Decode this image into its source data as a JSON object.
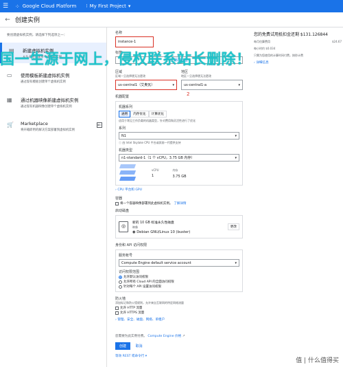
{
  "topbar": {
    "brand": "Google Cloud Platform",
    "project": "My First Project"
  },
  "header": {
    "title": "创建实例"
  },
  "left": {
    "intro": "要创建虚拟机实例，请选择下列选项之一：",
    "options": [
      {
        "label": "新建虚拟机实例",
        "desc": "从头开始创建单个虚拟机实例"
      },
      {
        "label": "使用模板新建虚拟机实例",
        "desc": "通过现有模板创建单个虚拟机实例"
      },
      {
        "label": "通过机器映像新建虚拟机实例",
        "desc": "通过现有机器映像创建单个虚拟机实例"
      },
      {
        "label": "Marketplace",
        "desc": "将开箱即用的解决方案部署到虚拟机实例"
      }
    ]
  },
  "form": {
    "name_label": "名称",
    "name_value": "instance-1",
    "label_label": "标签",
    "add_label": "+ 添加标签",
    "region_label": "区域",
    "region_hint": "区域一旦选择便无法更改",
    "region_value": "us-central1（艾奥瓦）",
    "zone_label": "地区",
    "zone_hint": "地区一旦选择便无法更改",
    "zone_value": "us-central1-a",
    "machine_config": "机器配置",
    "machine_family": "机器系列",
    "tabs": [
      "通用",
      "内存优化",
      "计算优化"
    ],
    "family_desc": "适用于常见工作负载的机器类型，针对费用和灵活性进行了优化",
    "series_label": "系列",
    "series_value": "N1",
    "series_hint": "由 Intel Skylake CPU 平台或其前一代提供支持",
    "type_label": "机器类型",
    "type_value": "n1-standard-1（1 个 vCPU，3.75 GB 内存）",
    "vcpu_head": "vCPU",
    "mem_head": "内存",
    "vcpu_value": "1",
    "mem_value": "3.75 GB",
    "cpu_link": "CPU 平台和 GPU",
    "container_label": "容器",
    "container_text": "将一个容器映像部署到此虚拟机实例。",
    "container_link": "了解详情",
    "disk_label": "启动磁盘",
    "disk_title": "新的 10 GB 标准永久性磁盘",
    "disk_image_label": "映像",
    "disk_image": "Debian GNU/Linux 10 (buster)",
    "change_button": "更改",
    "identity_label": "身份和 API 访问权限",
    "sa_label": "服务帐号",
    "sa_value": "Compute Engine default service account",
    "scope_label": "访问权限范围",
    "scopes": [
      "允许默认访问权限",
      "允许所有 Cloud API 的全面访问权限",
      "针对每个 API 设置访问权限"
    ],
    "firewall_label": "防火墙",
    "firewall_hint": "添加标记和防火墙规则，允许来自互联网的特定网络流量",
    "http": "允许 HTTP 流量",
    "https": "允许 HTTPS 流量",
    "more_link": "管理、安全、磁盘、网络、单租户",
    "billing_note": "您需要为此实例付费。",
    "pricing_link": "Compute Engine 价格",
    "create_button": "创建",
    "cancel_button": "取消",
    "rest_link": "等效 REST 或命令行"
  },
  "right": {
    "trial": "您的免费试用抵扣金还剩 $131.126844",
    "monthly_label": "每月估算费用",
    "monthly_value": "$24.67",
    "hourly": "每小时约 $0.034",
    "note": "只需为您使用的计算时间付费，按秒计费",
    "details": "详细信息"
  },
  "annotations": {
    "red1": "1",
    "red2": "2"
  },
  "watermark": "国一生源于网上，侵权联系站长删除！",
  "footer_watermark": "值 | 什么值得买"
}
